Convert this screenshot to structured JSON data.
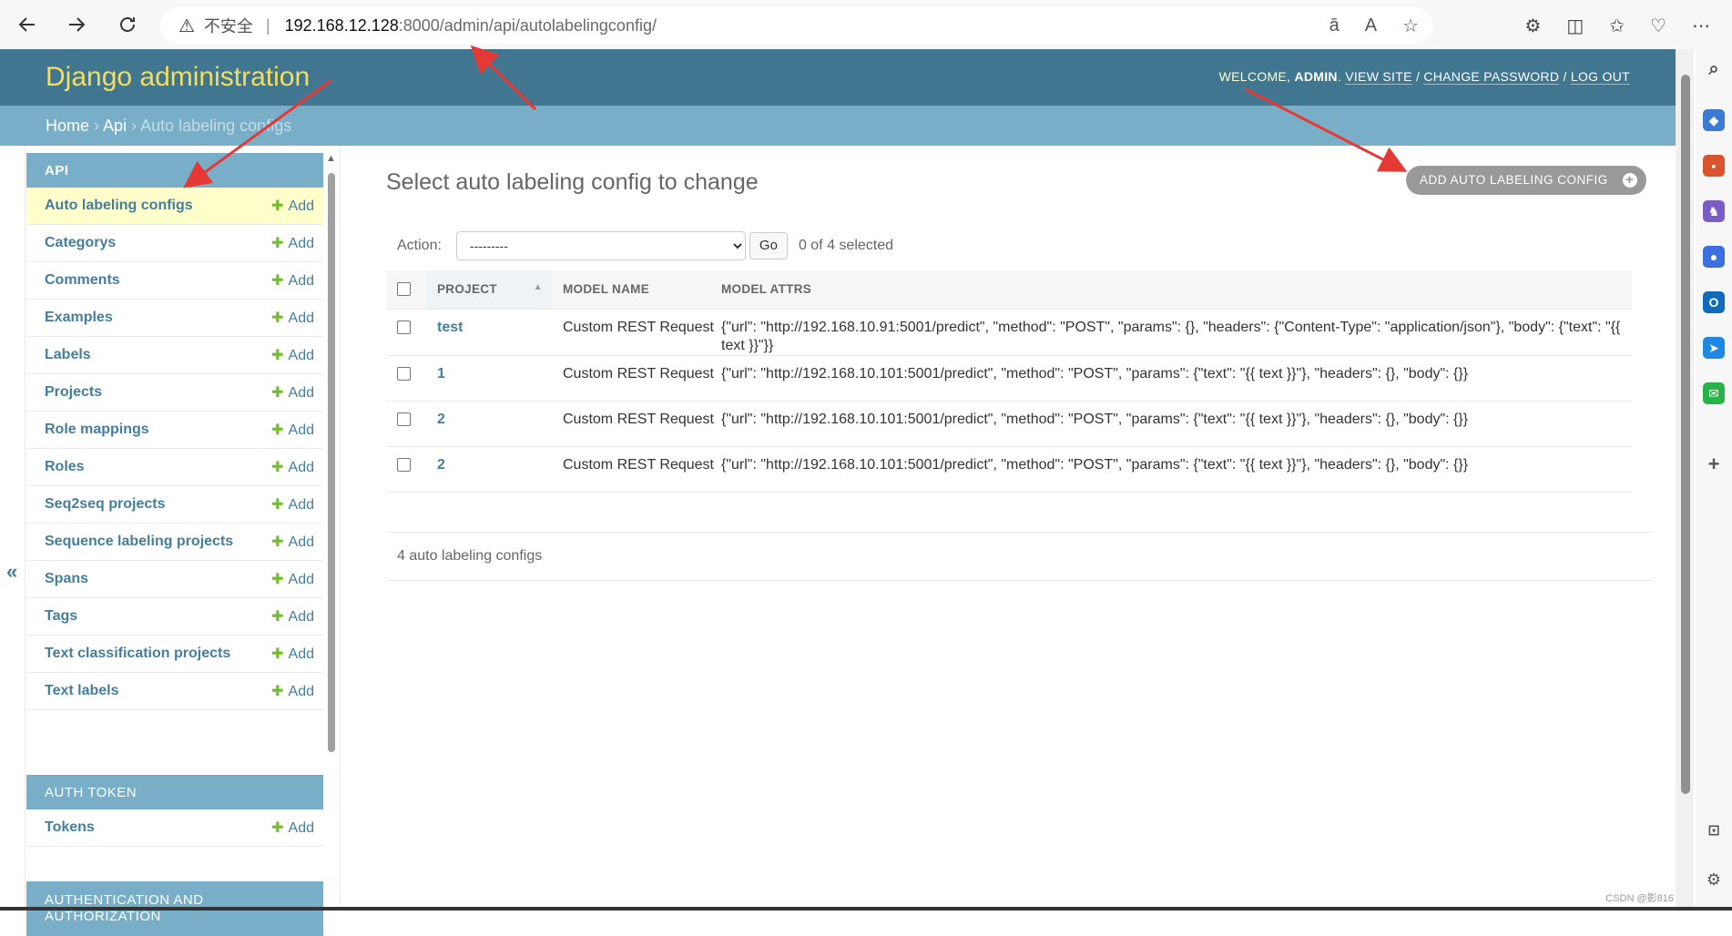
{
  "browser": {
    "url_security": "不安全",
    "url_host": "192.168.12.128",
    "url_path": ":8000/admin/api/autolabelingconfig/"
  },
  "header": {
    "site_name": "Django administration",
    "welcome": "WELCOME,",
    "user": "ADMIN",
    "view_site": "VIEW SITE",
    "change_password": "CHANGE PASSWORD",
    "log_out": "LOG OUT",
    "sep": "/"
  },
  "breadcrumbs": {
    "home": "Home",
    "app": "Api",
    "current": "Auto labeling configs",
    "sep": "›"
  },
  "sidebar": {
    "add_label": "Add",
    "api_caption": "API",
    "api_items": [
      "Auto labeling configs",
      "Categorys",
      "Comments",
      "Examples",
      "Labels",
      "Projects",
      "Role mappings",
      "Roles",
      "Seq2seq projects",
      "Sequence labeling projects",
      "Spans",
      "Tags",
      "Text classification projects",
      "Text labels"
    ],
    "auth_token_caption": "AUTH TOKEN",
    "auth_token_items": [
      "Tokens"
    ],
    "auth_caption_line1": "AUTHENTICATION AND",
    "auth_caption_line2": "AUTHORIZATION",
    "toggle": "«"
  },
  "main": {
    "title": "Select auto labeling config to change",
    "add_button": "ADD AUTO LABELING CONFIG",
    "action_label": "Action:",
    "action_selected": "---------",
    "go": "Go",
    "selected_count": "0 of 4 selected",
    "columns": [
      "PROJECT",
      "MODEL NAME",
      "MODEL ATTRS"
    ],
    "rows": [
      {
        "project": "test",
        "model_name": "Custom REST Request",
        "model_attrs": "{\"url\": \"http://192.168.10.91:5001/predict\", \"method\": \"POST\", \"params\": {}, \"headers\": {\"Content-Type\": \"application/json\"}, \"body\": {\"text\": \"{{ text }}\"}}"
      },
      {
        "project": "1",
        "model_name": "Custom REST Request",
        "model_attrs": "{\"url\": \"http://192.168.10.101:5001/predict\", \"method\": \"POST\", \"params\": {\"text\": \"{{ text }}\"}, \"headers\": {}, \"body\": {}}"
      },
      {
        "project": "2",
        "model_name": "Custom REST Request",
        "model_attrs": "{\"url\": \"http://192.168.10.101:5001/predict\", \"method\": \"POST\", \"params\": {\"text\": \"{{ text }}\"}, \"headers\": {}, \"body\": {}}"
      },
      {
        "project": "2",
        "model_name": "Custom REST Request",
        "model_attrs": "{\"url\": \"http://192.168.10.101:5001/predict\", \"method\": \"POST\", \"params\": {\"text\": \"{{ text }}\"}, \"headers\": {}, \"body\": {}}"
      }
    ],
    "paginator": "4 auto labeling configs"
  },
  "watermark": "CSDN @影816",
  "colors": {
    "header": "#417690",
    "breadcrumbs": "#79aec8",
    "branding": "#f5dd5d",
    "link": "#447e9b",
    "add_plus": "#70bf2b",
    "current_row": "#ffffcc",
    "annotation_arrow": "#e53935"
  }
}
